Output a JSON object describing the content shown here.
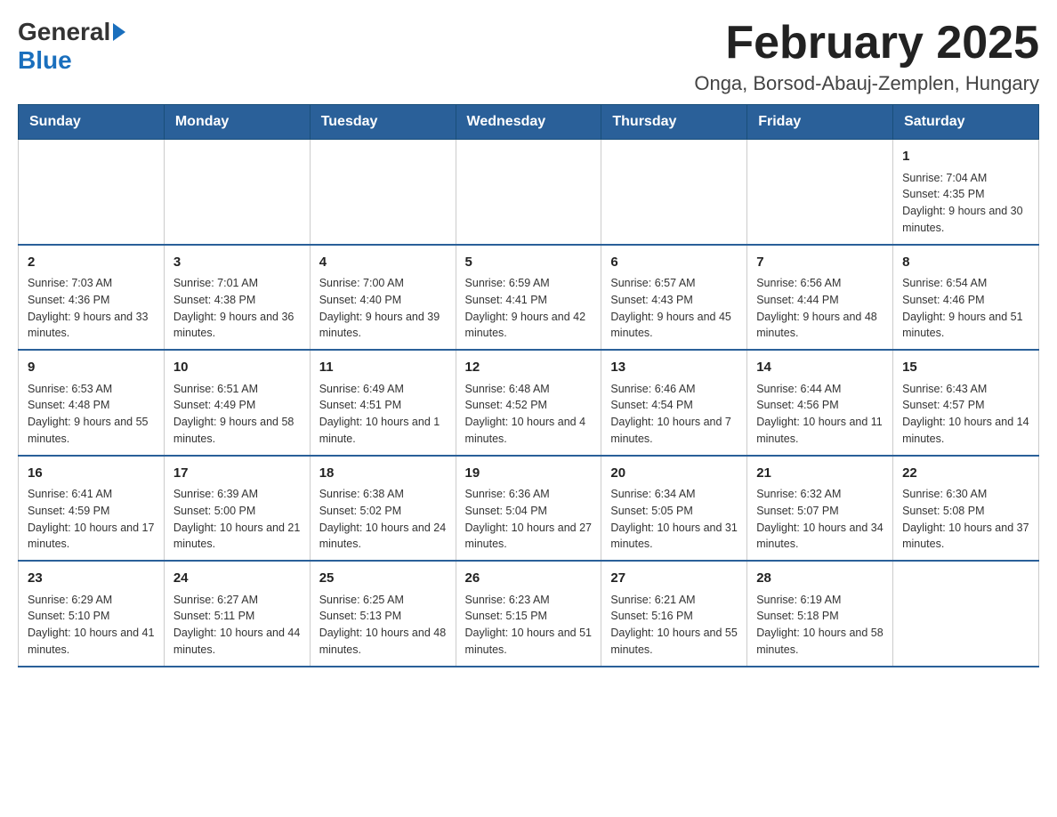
{
  "header": {
    "logo_general": "General",
    "logo_blue": "Blue",
    "month_title": "February 2025",
    "location": "Onga, Borsod-Abauj-Zemplen, Hungary"
  },
  "weekdays": [
    "Sunday",
    "Monday",
    "Tuesday",
    "Wednesday",
    "Thursday",
    "Friday",
    "Saturday"
  ],
  "weeks": [
    [
      {
        "day": "",
        "info": ""
      },
      {
        "day": "",
        "info": ""
      },
      {
        "day": "",
        "info": ""
      },
      {
        "day": "",
        "info": ""
      },
      {
        "day": "",
        "info": ""
      },
      {
        "day": "",
        "info": ""
      },
      {
        "day": "1",
        "info": "Sunrise: 7:04 AM\nSunset: 4:35 PM\nDaylight: 9 hours and 30 minutes."
      }
    ],
    [
      {
        "day": "2",
        "info": "Sunrise: 7:03 AM\nSunset: 4:36 PM\nDaylight: 9 hours and 33 minutes."
      },
      {
        "day": "3",
        "info": "Sunrise: 7:01 AM\nSunset: 4:38 PM\nDaylight: 9 hours and 36 minutes."
      },
      {
        "day": "4",
        "info": "Sunrise: 7:00 AM\nSunset: 4:40 PM\nDaylight: 9 hours and 39 minutes."
      },
      {
        "day": "5",
        "info": "Sunrise: 6:59 AM\nSunset: 4:41 PM\nDaylight: 9 hours and 42 minutes."
      },
      {
        "day": "6",
        "info": "Sunrise: 6:57 AM\nSunset: 4:43 PM\nDaylight: 9 hours and 45 minutes."
      },
      {
        "day": "7",
        "info": "Sunrise: 6:56 AM\nSunset: 4:44 PM\nDaylight: 9 hours and 48 minutes."
      },
      {
        "day": "8",
        "info": "Sunrise: 6:54 AM\nSunset: 4:46 PM\nDaylight: 9 hours and 51 minutes."
      }
    ],
    [
      {
        "day": "9",
        "info": "Sunrise: 6:53 AM\nSunset: 4:48 PM\nDaylight: 9 hours and 55 minutes."
      },
      {
        "day": "10",
        "info": "Sunrise: 6:51 AM\nSunset: 4:49 PM\nDaylight: 9 hours and 58 minutes."
      },
      {
        "day": "11",
        "info": "Sunrise: 6:49 AM\nSunset: 4:51 PM\nDaylight: 10 hours and 1 minute."
      },
      {
        "day": "12",
        "info": "Sunrise: 6:48 AM\nSunset: 4:52 PM\nDaylight: 10 hours and 4 minutes."
      },
      {
        "day": "13",
        "info": "Sunrise: 6:46 AM\nSunset: 4:54 PM\nDaylight: 10 hours and 7 minutes."
      },
      {
        "day": "14",
        "info": "Sunrise: 6:44 AM\nSunset: 4:56 PM\nDaylight: 10 hours and 11 minutes."
      },
      {
        "day": "15",
        "info": "Sunrise: 6:43 AM\nSunset: 4:57 PM\nDaylight: 10 hours and 14 minutes."
      }
    ],
    [
      {
        "day": "16",
        "info": "Sunrise: 6:41 AM\nSunset: 4:59 PM\nDaylight: 10 hours and 17 minutes."
      },
      {
        "day": "17",
        "info": "Sunrise: 6:39 AM\nSunset: 5:00 PM\nDaylight: 10 hours and 21 minutes."
      },
      {
        "day": "18",
        "info": "Sunrise: 6:38 AM\nSunset: 5:02 PM\nDaylight: 10 hours and 24 minutes."
      },
      {
        "day": "19",
        "info": "Sunrise: 6:36 AM\nSunset: 5:04 PM\nDaylight: 10 hours and 27 minutes."
      },
      {
        "day": "20",
        "info": "Sunrise: 6:34 AM\nSunset: 5:05 PM\nDaylight: 10 hours and 31 minutes."
      },
      {
        "day": "21",
        "info": "Sunrise: 6:32 AM\nSunset: 5:07 PM\nDaylight: 10 hours and 34 minutes."
      },
      {
        "day": "22",
        "info": "Sunrise: 6:30 AM\nSunset: 5:08 PM\nDaylight: 10 hours and 37 minutes."
      }
    ],
    [
      {
        "day": "23",
        "info": "Sunrise: 6:29 AM\nSunset: 5:10 PM\nDaylight: 10 hours and 41 minutes."
      },
      {
        "day": "24",
        "info": "Sunrise: 6:27 AM\nSunset: 5:11 PM\nDaylight: 10 hours and 44 minutes."
      },
      {
        "day": "25",
        "info": "Sunrise: 6:25 AM\nSunset: 5:13 PM\nDaylight: 10 hours and 48 minutes."
      },
      {
        "day": "26",
        "info": "Sunrise: 6:23 AM\nSunset: 5:15 PM\nDaylight: 10 hours and 51 minutes."
      },
      {
        "day": "27",
        "info": "Sunrise: 6:21 AM\nSunset: 5:16 PM\nDaylight: 10 hours and 55 minutes."
      },
      {
        "day": "28",
        "info": "Sunrise: 6:19 AM\nSunset: 5:18 PM\nDaylight: 10 hours and 58 minutes."
      },
      {
        "day": "",
        "info": ""
      }
    ]
  ]
}
